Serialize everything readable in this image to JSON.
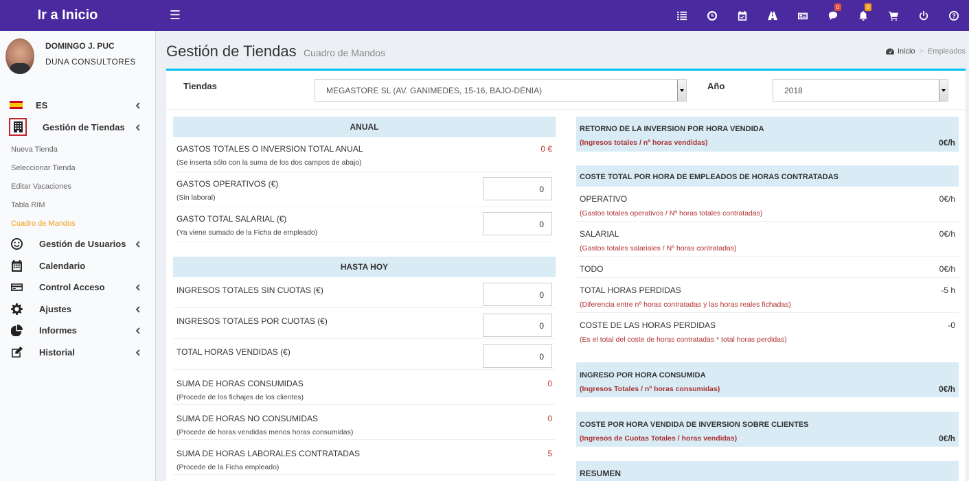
{
  "app": {
    "logo": "Ir a Inicio"
  },
  "topbar": {
    "icons": [
      {
        "name": "list-icon"
      },
      {
        "name": "clock-icon"
      },
      {
        "name": "calendar-check-icon"
      },
      {
        "name": "road-icon"
      },
      {
        "name": "newspaper-icon"
      },
      {
        "name": "comments-icon",
        "badge": "0"
      },
      {
        "name": "bell-icon",
        "badge": "0"
      },
      {
        "name": "cart-icon"
      },
      {
        "name": "power-icon"
      },
      {
        "name": "help-icon"
      }
    ]
  },
  "user": {
    "name": "DOMINGO J. PUC",
    "company": "DUNA CONSULTORES"
  },
  "sidebar": {
    "language": "ES",
    "tiendas": "Gestión de Tiendas",
    "submenu": [
      "Nueva Tienda",
      "Seleccionar Tienda",
      "Editar Vacaciones",
      "Tabla RIM",
      "Cuadro de Mandos"
    ],
    "items": [
      "Gestión de Usuarios",
      "Calendario",
      "Control Acceso",
      "Ajustes",
      "Informes",
      "Historial"
    ]
  },
  "header": {
    "title": "Gestión de Tiendas",
    "subtitle": "Cuadro de Mandos",
    "breadcrumb": [
      "Inicio",
      ">",
      "Empleados"
    ]
  },
  "filters": {
    "tiendas_label": "Tiendas",
    "tiendas_value": "MEGASTORE SL (AV. GANIMEDES, 15-16, BAJO-DÉNIA)",
    "anio_label": "Año",
    "anio_value": "2018"
  },
  "anual": {
    "heading": "ANUAL",
    "rows": [
      {
        "label": "GASTOS TOTALES O INVERSION TOTAL ANUAL",
        "hint": "(Se inserta sólo con la suma de los dos campos de abajo)",
        "value": "0 €"
      },
      {
        "label": "GASTOS OPERATIVOS (€)",
        "hint": "(Sin laboral)",
        "input": "0"
      },
      {
        "label": "GASTO TOTAL SALARIAL (€)",
        "hint": "(Ya viene sumado de la Ficha de empleado)",
        "input": "0"
      }
    ]
  },
  "hasta_hoy": {
    "heading": "HASTA HOY",
    "rows": [
      {
        "label": "INGRESOS TOTALES SIN CUOTAS (€)",
        "input": "0"
      },
      {
        "label": "INGRESOS TOTALES POR CUOTAS (€)",
        "input": "0"
      },
      {
        "label": "TOTAL HORAS VENDIDAS (€)",
        "input": "0"
      },
      {
        "label": "SUMA DE HORAS CONSUMIDAS",
        "hint": "(Procede de los fichajes de los clientes)",
        "value": "0"
      },
      {
        "label": "SUMA DE HORAS NO CONSUMIDAS",
        "hint": "(Procede de horas vendidas menos horas consumidas)",
        "value": "0"
      },
      {
        "label": "SUMA DE HORAS LABORALES CONTRATADAS",
        "hint": "(Procede de la Ficha empleado)",
        "value": "5"
      }
    ]
  },
  "right": {
    "retorno": {
      "title": "RETORNO DE LA INVERSION POR HORA VENDIDA",
      "sub": "(Ingresos totales / nº horas vendidas)",
      "value": "0€/h"
    },
    "coste_total": {
      "title": "COSTE TOTAL POR HORA DE EMPLEADOS DE HORAS CONTRATADAS",
      "rows": [
        {
          "label": "OPERATIVO",
          "hint": "(Gastos totales operativos / Nº horas totales contratadas)",
          "value": "0€/h"
        },
        {
          "label": "SALARIAL",
          "hint": "(Gastos totales salariales / Nº horas contratadas)",
          "value": "0€/h"
        },
        {
          "label": "TODO",
          "value": "0€/h"
        },
        {
          "label": "TOTAL HORAS PERDIDAS",
          "hint": "(Diferencia entre nº horas contratadas y las horas reales fichadas)",
          "value": "-5 h"
        },
        {
          "label": "COSTE DE LAS HORAS PERDIDAS",
          "hint": "(Es el total del coste de horas contratadas * total horas perdidas)",
          "value": "-0"
        }
      ]
    },
    "ingreso": {
      "title": "INGRESO POR HORA CONSUMIDA",
      "sub": "(Ingresos Totales / nº horas consumidas)",
      "value": "0€/h"
    },
    "coste_vendida": {
      "title": "COSTE POR HORA VENDIDA DE INVERSION SOBRE CLIENTES",
      "sub": "(Ingresos de Cuotas Totales / horas vendidas)",
      "value": "0€/h"
    },
    "resumen": {
      "title": "RESUMEN"
    }
  }
}
